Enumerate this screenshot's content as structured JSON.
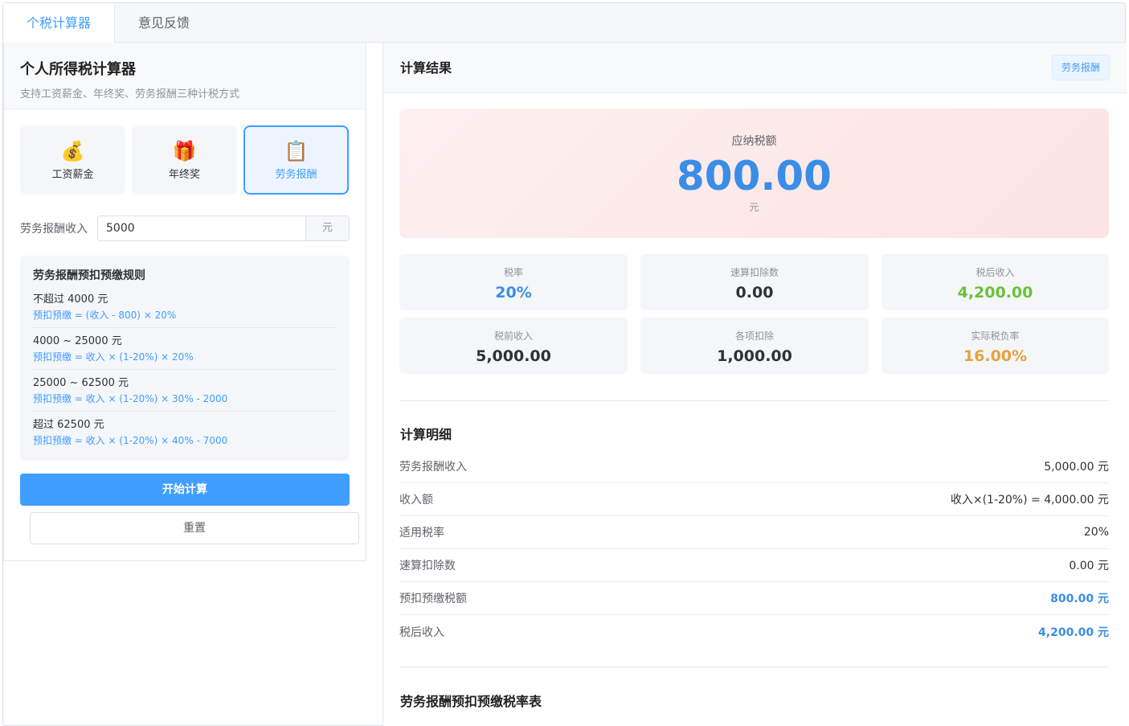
{
  "tabs": [
    "个税计算器",
    "意见反馈"
  ],
  "left": {
    "title": "个人所得税计算器",
    "subtitle": "支持工资薪金、年终奖、劳务报酬三种计税方式",
    "types": [
      {
        "icon": "money-bag-icon",
        "glyph": "💰",
        "label": "工资薪金"
      },
      {
        "icon": "gift-icon",
        "glyph": "🎁",
        "label": "年终奖"
      },
      {
        "icon": "clipboard-icon",
        "glyph": "📋",
        "label": "劳务报酬"
      }
    ],
    "input_label": "劳务报酬收入",
    "input_value": "5000",
    "input_unit": "元",
    "rules_title": "劳务报酬预扣预缴规则",
    "rules": [
      {
        "range": "不超过 4000 元",
        "formula": "预扣预缴 = (收入 - 800) × 20%"
      },
      {
        "range": "4000 ~ 25000 元",
        "formula": "预扣预缴 = 收入 × (1-20%) × 20%"
      },
      {
        "range": "25000 ~ 62500 元",
        "formula": "预扣预缴 = 收入 × (1-20%) × 30% - 2000"
      },
      {
        "range": "超过 62500 元",
        "formula": "预扣预缴 = 收入 × (1-20%) × 40% - 7000"
      }
    ],
    "calc_button": "开始计算",
    "reset_button": "重置"
  },
  "right": {
    "title": "计算结果",
    "tag": "劳务报酬",
    "tax_label": "应纳税额",
    "tax_value": "800.00",
    "tax_unit": "元",
    "stats": [
      {
        "label": "税率",
        "value": "20%"
      },
      {
        "label": "速算扣除数",
        "value": "0.00"
      },
      {
        "label": "税后收入",
        "value": "4,200.00"
      },
      {
        "label": "税前收入",
        "value": "5,000.00"
      },
      {
        "label": "各项扣除",
        "value": "1,000.00"
      },
      {
        "label": "实际税负率",
        "value": "16.00%"
      }
    ],
    "detail_title": "计算明细",
    "details": [
      {
        "label": "劳务报酬收入",
        "value": "5,000.00 元"
      },
      {
        "label": "收入额",
        "value": "收入×(1-20%) = 4,000.00 元"
      },
      {
        "label": "适用税率",
        "value": "20%"
      },
      {
        "label": "速算扣除数",
        "value": "0.00 元"
      },
      {
        "label": "预扣预缴税额",
        "value": "800.00 元"
      },
      {
        "label": "税后收入",
        "value": "4,200.00 元"
      }
    ],
    "table_title": "劳务报酬预扣预缴税率表"
  }
}
